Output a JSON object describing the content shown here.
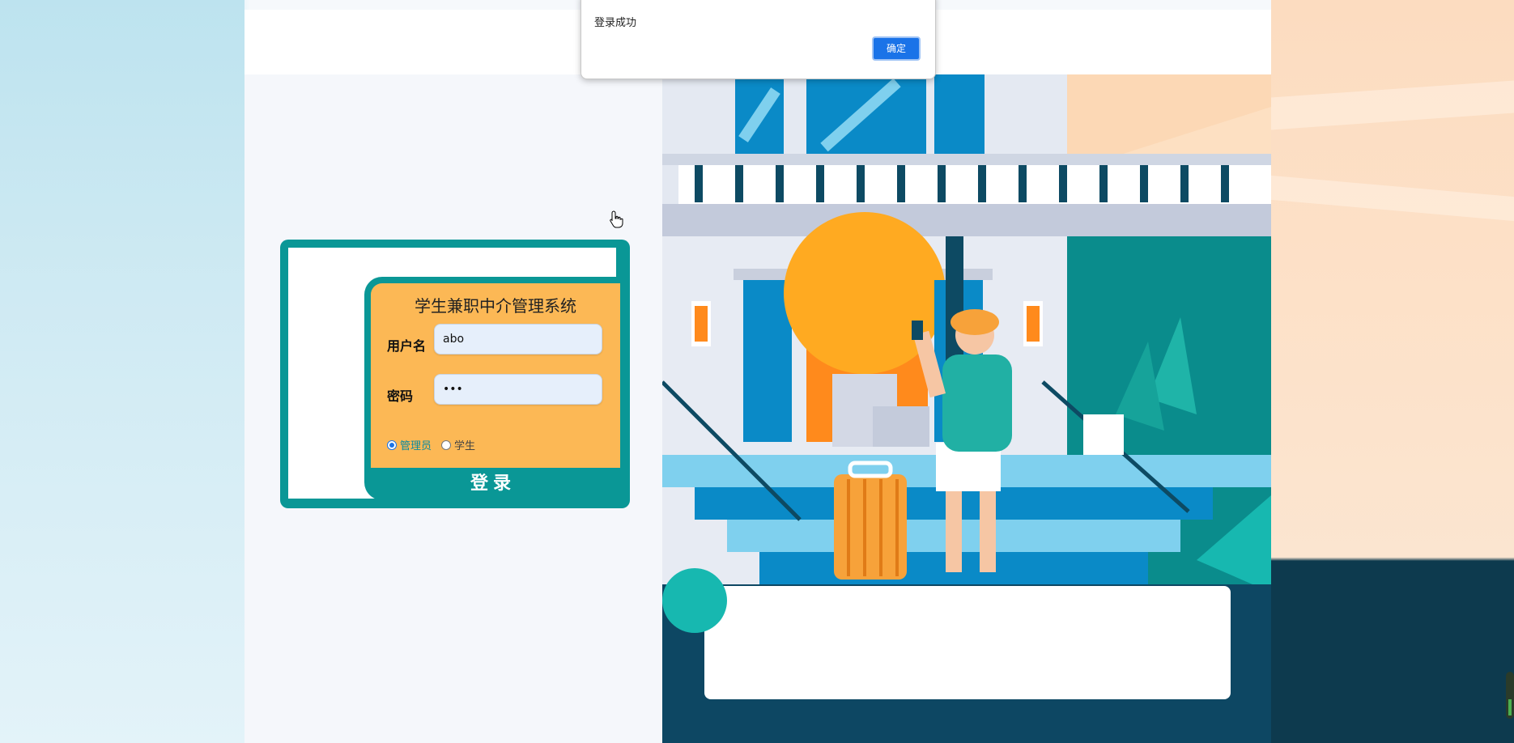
{
  "login": {
    "title": "学生兼职中介管理系统",
    "username_label": "用户名",
    "username_value": "abo",
    "password_label": "密码",
    "password_value": "•••",
    "roles": [
      {
        "label": "管理员",
        "checked": true
      },
      {
        "label": "学生",
        "checked": false
      }
    ],
    "submit_label": "登录"
  },
  "alert": {
    "message": "登录成功",
    "ok_label": "确定"
  },
  "colors": {
    "teal": "#0a9796",
    "form_orange": "#fcb855",
    "alert_button": "#1a73e8"
  }
}
